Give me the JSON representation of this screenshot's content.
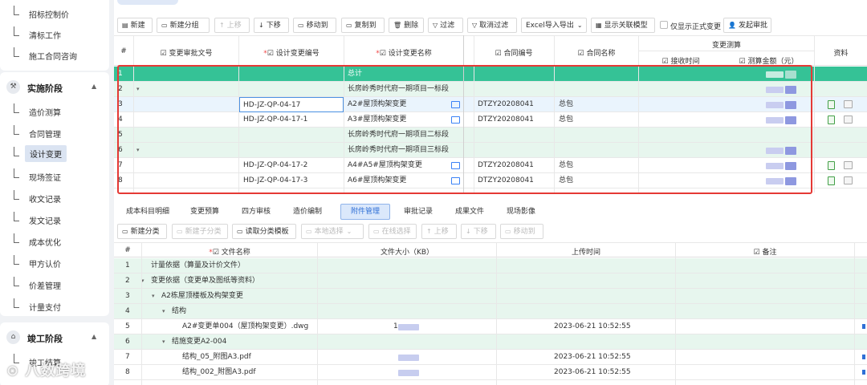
{
  "sidebar": {
    "top_items": [
      "招标控制价",
      "清标工作",
      "施工合同咨询"
    ],
    "section_impl": {
      "title": "实施阶段",
      "icon": "hammer-icon"
    },
    "impl_items": [
      "造价测算",
      "合同管理",
      "设计变更",
      "现场签证",
      "收文记录",
      "发文记录",
      "成本优化",
      "甲方认价",
      "价差管理",
      "计量支付"
    ],
    "active_item": "设计变更",
    "section_done": {
      "title": "竣工阶段",
      "icon": "building-icon"
    },
    "done_items": [
      "竣工结算"
    ],
    "watermark": "八数跨境"
  },
  "toolbar": {
    "buttons": [
      "新建",
      "新建分组",
      "上移",
      "下移",
      "移动到",
      "复制到",
      "删除",
      "过滤",
      "取消过滤",
      "Excel导入导出",
      "显示关联模型"
    ],
    "checkbox_label": "仅显示正式变更",
    "submit_button": "发起审批"
  },
  "top_table": {
    "headers": {
      "index": "#",
      "approval_no": "变更审批文号",
      "change_no": "设计变更编号",
      "change_name": "设计变更名称",
      "contract_no": "合同编号",
      "contract_name": "合同名称",
      "calc_group": "变更测算",
      "receive_time": "接收时间",
      "calc_amount": "测算金额（元）",
      "docs": "资料"
    },
    "rows": [
      {
        "n": "1",
        "approval": "",
        "no": "",
        "name": "总计",
        "cno": "",
        "cname": "",
        "style": "total",
        "caret": false
      },
      {
        "n": "2",
        "approval": "",
        "no": "",
        "name": "长房岭秀时代府一期项目一标段",
        "cno": "",
        "cname": "",
        "style": "green",
        "caret": true
      },
      {
        "n": "3",
        "approval": "",
        "no": "HD-JZ-QP-04-17",
        "name": "A2#屋顶构架变更",
        "cno": "DTZY20208041",
        "cname": "总包",
        "style": "blue",
        "caret": false
      },
      {
        "n": "4",
        "approval": "",
        "no": "HD-JZ-QP-04-17-1",
        "name": "A3#屋顶构架变更",
        "cno": "DTZY20208041",
        "cname": "总包",
        "style": "white",
        "caret": false
      },
      {
        "n": "5",
        "approval": "",
        "no": "",
        "name": "长房岭秀时代府一期项目二标段",
        "cno": "",
        "cname": "",
        "style": "green",
        "caret": false
      },
      {
        "n": "6",
        "approval": "",
        "no": "",
        "name": "长房岭秀时代府一期项目三标段",
        "cno": "",
        "cname": "",
        "style": "green",
        "caret": true
      },
      {
        "n": "7",
        "approval": "",
        "no": "HD-JZ-QP-04-17-2",
        "name": "A4#A5#屋顶构架变更",
        "cno": "DTZY20208041",
        "cname": "总包",
        "style": "white",
        "caret": false
      },
      {
        "n": "8",
        "approval": "",
        "no": "HD-JZ-QP-04-17-3",
        "name": "A6#屋顶构架变更",
        "cno": "DTZY20208041",
        "cname": "总包",
        "style": "white",
        "caret": false
      }
    ]
  },
  "bottom_tabs": [
    "成本科目明细",
    "变更预算",
    "四方审核",
    "造价编制",
    "附件管理",
    "审批记录",
    "成果文件",
    "现场影像"
  ],
  "active_bottom_tab": "附件管理",
  "attach_toolbar": {
    "buttons": [
      "新建分类",
      "新建子分类",
      "读取分类模板",
      "本地选择",
      "在线选择",
      "上移",
      "下移",
      "移动到"
    ]
  },
  "attach_table": {
    "headers": {
      "index": "#",
      "file_name": "文件名称",
      "size": "文件大小（KB）",
      "upload_time": "上传时间",
      "note": "备注"
    },
    "rows": [
      {
        "n": "1",
        "name": "计量依据（算量及计价文件）",
        "indent": 0,
        "caret": false,
        "size": "",
        "time": "",
        "style": "green"
      },
      {
        "n": "2",
        "name": "变更依据（变更单及图纸等资料）",
        "indent": 0,
        "caret": true,
        "size": "",
        "time": "",
        "style": "green"
      },
      {
        "n": "3",
        "name": "A2栋屋顶楼板及构架变更",
        "indent": 1,
        "caret": true,
        "size": "",
        "time": "",
        "style": "green"
      },
      {
        "n": "4",
        "name": "结构",
        "indent": 2,
        "caret": true,
        "size": "",
        "time": "",
        "style": "green"
      },
      {
        "n": "5",
        "name": "A2#变更单004（屋顶构架变更）.dwg",
        "indent": 3,
        "caret": false,
        "size": "1",
        "time": "2023-06-21 10:52:55",
        "style": "white"
      },
      {
        "n": "6",
        "name": "结施变更A2-004",
        "indent": 2,
        "caret": true,
        "size": "",
        "time": "",
        "style": "green"
      },
      {
        "n": "7",
        "name": "结构_05_附图A3.pdf",
        "indent": 3,
        "caret": false,
        "size": "",
        "time": "2023-06-21 10:52:55",
        "style": "white"
      },
      {
        "n": "8",
        "name": "结构_002_附图A3.pdf",
        "indent": 3,
        "caret": false,
        "size": "",
        "time": "2023-06-21 10:52:55",
        "style": "white"
      }
    ]
  },
  "colors": {
    "total_green": "#35c296",
    "group_green": "#e7f6ee",
    "highlight_red": "#e53935",
    "accent_blue": "#2f6fd6"
  }
}
